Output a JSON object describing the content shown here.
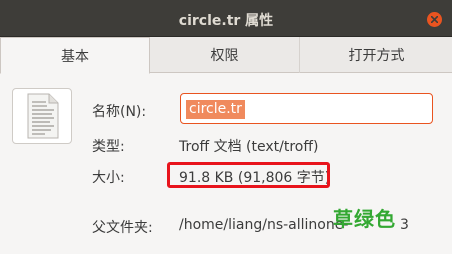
{
  "window": {
    "title": "circle.tr 属性"
  },
  "tabs": [
    {
      "label": "基本",
      "active": true
    },
    {
      "label": "权限",
      "active": false
    },
    {
      "label": "打开方式",
      "active": false
    }
  ],
  "basic": {
    "name_label": "名称(N):",
    "name_value": "circle.tr",
    "type_label": "类型:",
    "type_value": "Troff 文档 (text/troff)",
    "size_label": "大小:",
    "size_value": "91.8 KB (91,806 字节)",
    "parent_label": "父文件夹:",
    "parent_value": "/home/liang/ns-allinone-",
    "parent_tail": "3"
  },
  "overlay": {
    "watermark_text": "草绿色",
    "highlight_color": "#e8141c"
  },
  "icons": {
    "close": "close-icon",
    "file": "text-document-icon"
  },
  "colors": {
    "titlebar": "#3e3d39",
    "accent": "#e95420",
    "selection": "#f08a5d",
    "watermark": "#33a832"
  }
}
